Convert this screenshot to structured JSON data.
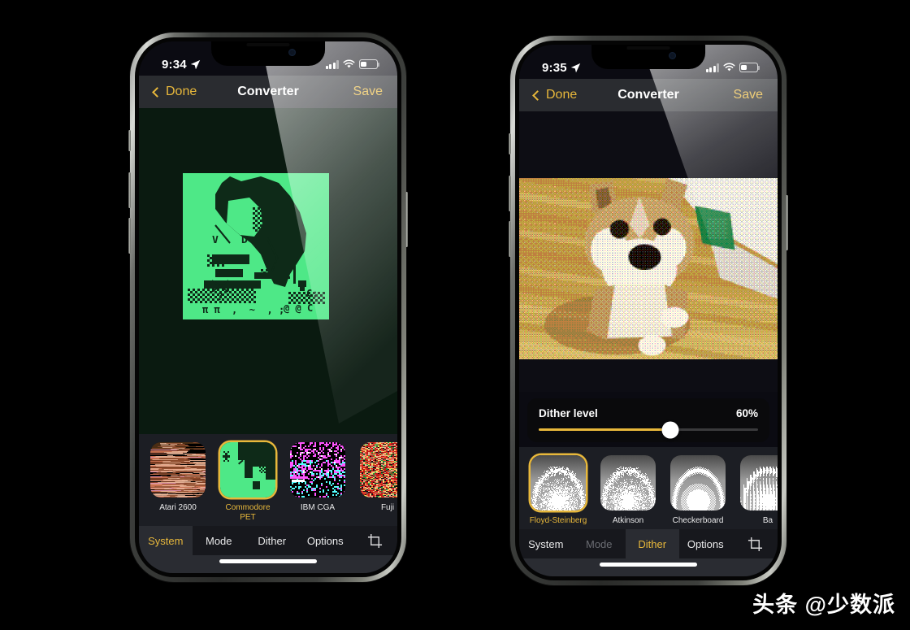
{
  "watermark": "头条 @少数派",
  "phones": [
    {
      "id": "left",
      "status": {
        "time": "9:34",
        "location_icon": "location-arrow-icon",
        "cellular_icon": "cellular-bars-icon",
        "wifi_icon": "wifi-icon",
        "battery_icon": "battery-icon"
      },
      "nav": {
        "back_label": "Done",
        "title": "Converter",
        "action_label": "Save"
      },
      "canvas": {
        "mode": "pet-art",
        "bg": "#0a1a10",
        "fg": "#4ee887"
      },
      "slider": null,
      "presets": [
        {
          "label": "Atari 2600",
          "selected": false,
          "thumb": "atari"
        },
        {
          "label": "Commodore PET",
          "selected": true,
          "thumb": "pet"
        },
        {
          "label": "IBM CGA",
          "selected": false,
          "thumb": "cga"
        },
        {
          "label": "Fuji",
          "selected": false,
          "thumb": "fuji"
        }
      ],
      "tabs": [
        {
          "label": "System",
          "state": "active"
        },
        {
          "label": "Mode",
          "state": "normal"
        },
        {
          "label": "Dither",
          "state": "normal"
        },
        {
          "label": "Options",
          "state": "normal"
        }
      ],
      "crop_icon": "crop-icon"
    },
    {
      "id": "right",
      "status": {
        "time": "9:35",
        "location_icon": "location-arrow-icon",
        "cellular_icon": "cellular-bars-icon",
        "wifi_icon": "wifi-icon",
        "battery_icon": "battery-icon"
      },
      "nav": {
        "back_label": "Done",
        "title": "Converter",
        "action_label": "Save"
      },
      "canvas": {
        "mode": "photo",
        "bg": "#000000"
      },
      "slider": {
        "label": "Dither level",
        "value_label": "60%",
        "percent": 60,
        "accent": "#e8b83b"
      },
      "presets": [
        {
          "label": "Floyd-Steinberg",
          "selected": true,
          "thumb": "dither"
        },
        {
          "label": "Atkinson",
          "selected": false,
          "thumb": "dither"
        },
        {
          "label": "Checkerboard",
          "selected": false,
          "thumb": "dither"
        },
        {
          "label": "Ba",
          "selected": false,
          "thumb": "dither"
        }
      ],
      "tabs": [
        {
          "label": "System",
          "state": "normal"
        },
        {
          "label": "Mode",
          "state": "disabled"
        },
        {
          "label": "Dither",
          "state": "active"
        },
        {
          "label": "Options",
          "state": "normal"
        }
      ],
      "crop_icon": "crop-icon"
    }
  ]
}
